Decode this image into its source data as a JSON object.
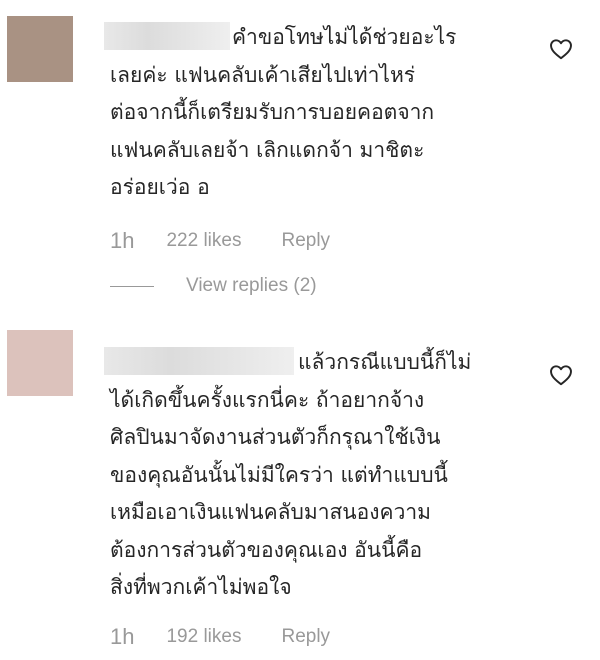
{
  "comments": [
    {
      "text": "คำขอโทษไม่ได้ช่วยอะไร\nเลยค่ะ แฟนคลับเค้าเสียไปเท่าไหร่\nต่อจากนี้ก็เตรียมรับการบอยคอตจาก\nแฟนคลับเลยจ้า เลิกแดกจ้า มาชิตะ\nอร่อยเว่อ อ",
      "time": "1h",
      "likes": "222 likes",
      "reply_label": "Reply",
      "view_replies": "View replies (2)",
      "avatar_color": "#a99283"
    },
    {
      "text": "แล้วกรณีแบบนี้ก็ไม่\nได้เกิดขึ้นครั้งแรกนี่คะ ถ้าอยากจ้าง\nศิลปินมาจัดงานส่วนตัวก็กรุณาใช้เงิน\nของคุณอันนั้นไม่มีใครว่า แต่ทำแบบนี้\nเหมือเอาเงินแฟนคลับมาสนองความ\nต้องการส่วนตัวของคุณเอง อันนี้คือ\nสิ่งที่พวกเค้าไม่พอใจ",
      "time": "1h",
      "likes": "192 likes",
      "reply_label": "Reply",
      "avatar_color": "#dcc2bc"
    }
  ],
  "icons": {
    "like": "heart-outline-icon"
  },
  "colors": {
    "text": "#262626",
    "meta": "#999999"
  }
}
